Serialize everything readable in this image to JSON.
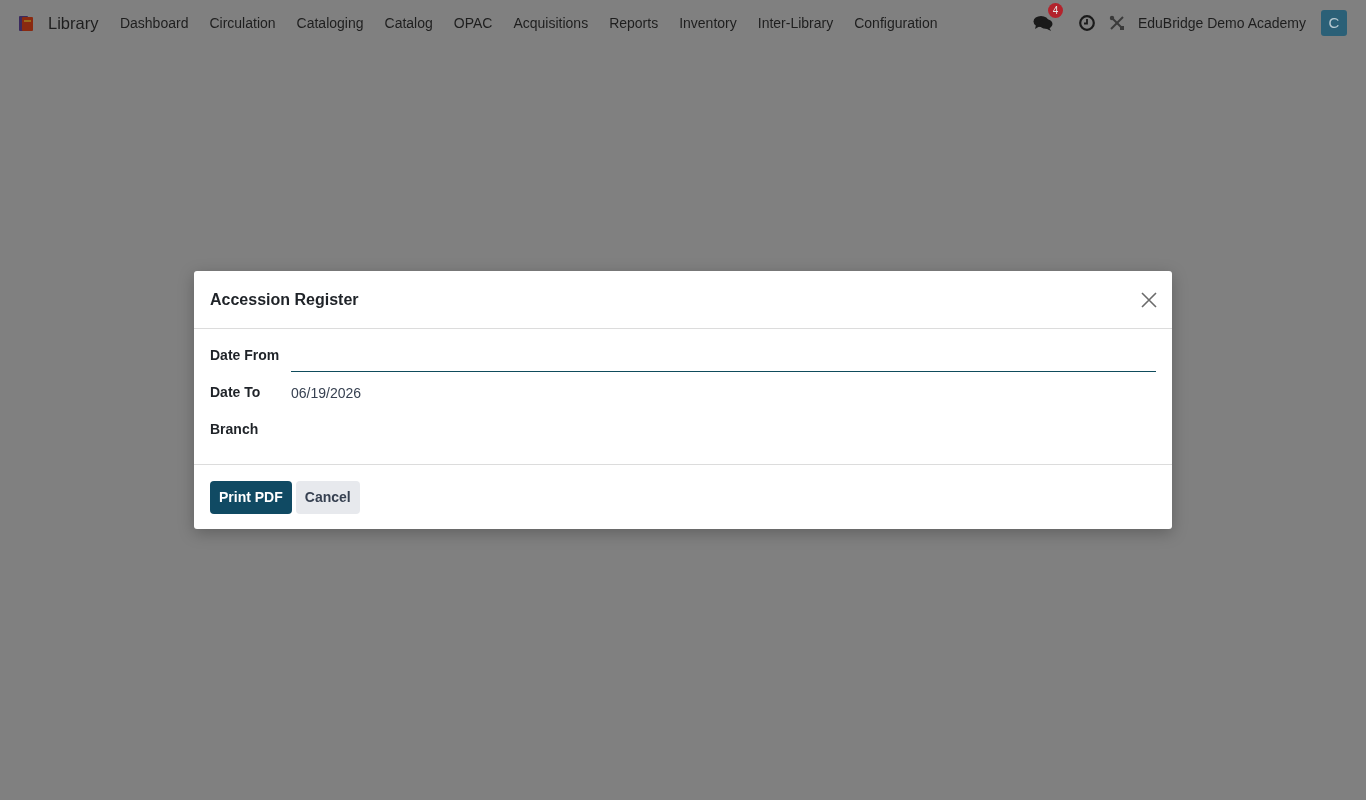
{
  "navbar": {
    "app_name": "Library",
    "menu": [
      "Dashboard",
      "Circulation",
      "Cataloging",
      "Catalog",
      "OPAC",
      "Acquisitions",
      "Reports",
      "Inventory",
      "Inter-Library",
      "Configuration"
    ],
    "messages_badge": "4",
    "company": "EduBridge Demo Academy",
    "avatar_initial": "C"
  },
  "dialog": {
    "title": "Accession Register",
    "fields": [
      {
        "label": "Date From",
        "focused": true
      },
      {
        "label": "Date To",
        "value": "06/19/2026",
        "focused": false
      },
      {
        "label": "Branch",
        "focused": false
      }
    ],
    "buttons": [
      {
        "label": "Print PDF",
        "kind": "primary"
      },
      {
        "label": "Cancel",
        "kind": "secondary"
      }
    ]
  }
}
